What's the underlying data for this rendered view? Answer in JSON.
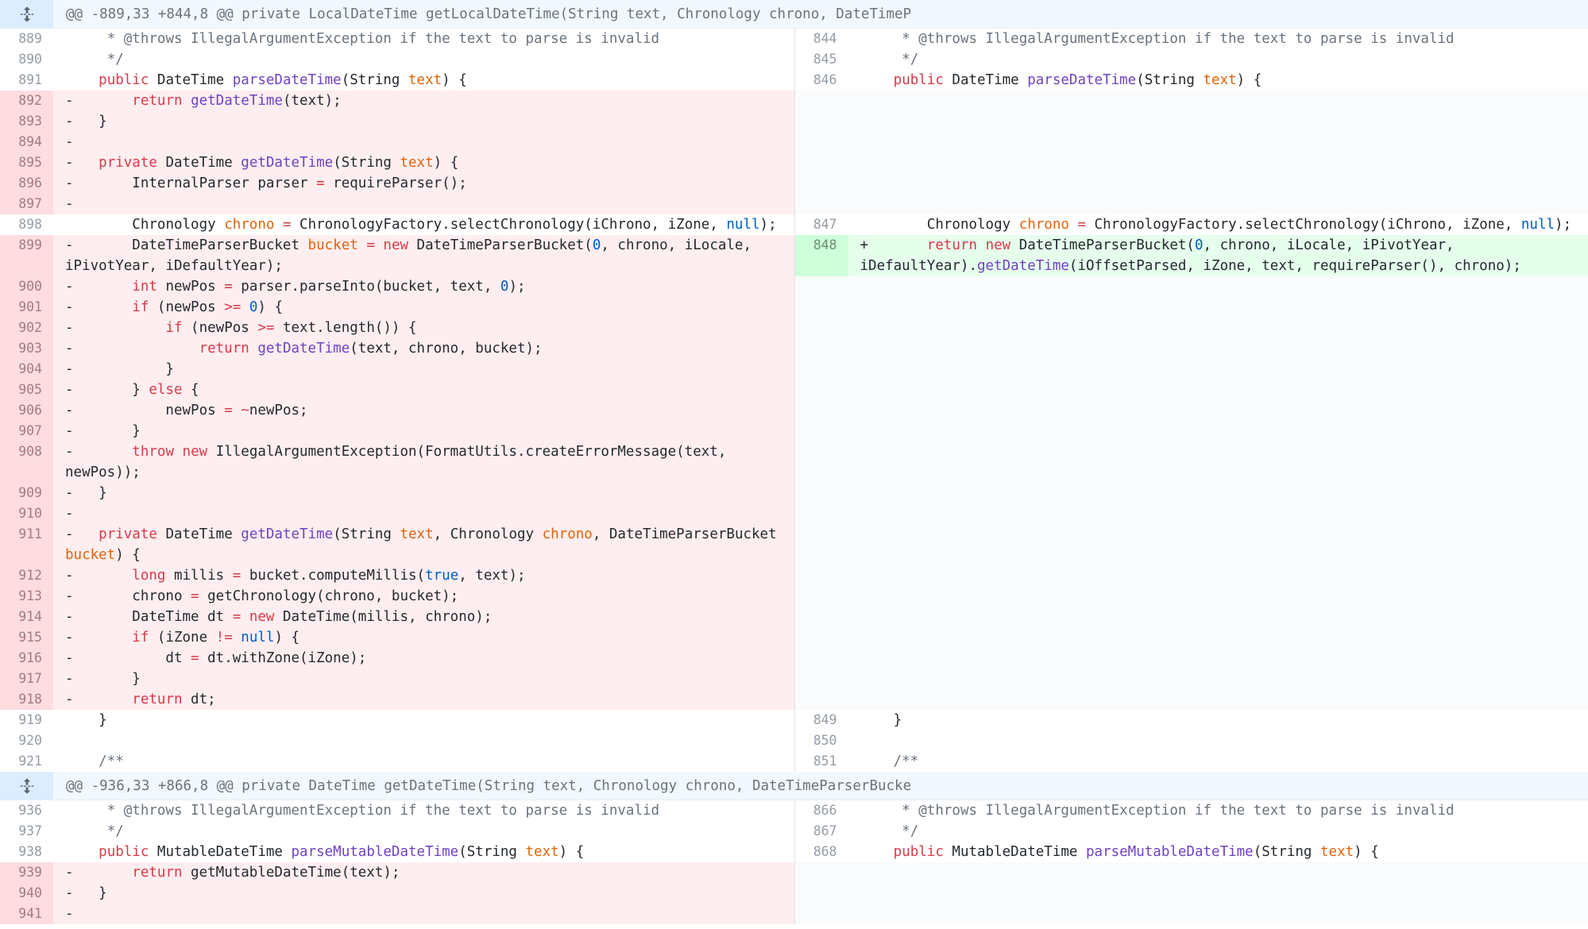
{
  "colors": {
    "deletion_bg": "#ffeef0",
    "addition_bg": "#e6ffed",
    "hunk_bg": "#f1f8ff",
    "keyword": "#d73a49",
    "function": "#6f42c1",
    "param": "#e36209",
    "literal": "#005cc5"
  },
  "expander_icon": "unfold-icon",
  "hunks": [
    {
      "header": "@@ -889,33 +844,8 @@ private LocalDateTime getLocalDateTime(String text, Chronology chrono, DateTimeP",
      "rows": [
        {
          "l": {
            "n": "889",
            "t": "ctx",
            "c": "     * @throws IllegalArgumentException if the text to parse is invalid"
          },
          "r": {
            "n": "844",
            "t": "ctx",
            "c": "     * @throws IllegalArgumentException if the text to parse is invalid"
          }
        },
        {
          "l": {
            "n": "890",
            "t": "ctx",
            "c": "     */"
          },
          "r": {
            "n": "845",
            "t": "ctx",
            "c": "     */"
          }
        },
        {
          "l": {
            "n": "891",
            "t": "ctx",
            "c": "    public DateTime parseDateTime(String text) {"
          },
          "r": {
            "n": "846",
            "t": "ctx",
            "c": "    public DateTime parseDateTime(String text) {"
          }
        },
        {
          "l": {
            "n": "892",
            "t": "del",
            "c": "-       return getDateTime(text);"
          },
          "r": {
            "n": "",
            "t": "empty",
            "c": ""
          }
        },
        {
          "l": {
            "n": "893",
            "t": "del",
            "c": "-   }"
          },
          "r": {
            "n": "",
            "t": "empty",
            "c": ""
          }
        },
        {
          "l": {
            "n": "894",
            "t": "del",
            "c": "-"
          },
          "r": {
            "n": "",
            "t": "empty",
            "c": ""
          }
        },
        {
          "l": {
            "n": "895",
            "t": "del",
            "c": "-   private DateTime getDateTime(String text) {"
          },
          "r": {
            "n": "",
            "t": "empty",
            "c": ""
          }
        },
        {
          "l": {
            "n": "896",
            "t": "del",
            "c": "-       InternalParser parser = requireParser();"
          },
          "r": {
            "n": "",
            "t": "empty",
            "c": ""
          }
        },
        {
          "l": {
            "n": "897",
            "t": "del",
            "c": "-"
          },
          "r": {
            "n": "",
            "t": "empty",
            "c": ""
          }
        },
        {
          "l": {
            "n": "898",
            "t": "ctx",
            "c": "        Chronology chrono = ChronologyFactory.selectChronology(iChrono, iZone, null);"
          },
          "r": {
            "n": "847",
            "t": "ctx",
            "c": "        Chronology chrono = ChronologyFactory.selectChronology(iChrono, iZone, null);"
          }
        },
        {
          "l": {
            "n": "899",
            "t": "del",
            "c": "-       DateTimeParserBucket bucket = new DateTimeParserBucket(0, chrono, iLocale, iPivotYear, iDefaultYear);"
          },
          "r": {
            "n": "848",
            "t": "add",
            "c": "+       return new DateTimeParserBucket(0, chrono, iLocale, iPivotYear, iDefaultYear).getDateTime(iOffsetParsed, iZone, text, requireParser(), chrono);"
          }
        },
        {
          "l": {
            "n": "900",
            "t": "del",
            "c": "-       int newPos = parser.parseInto(bucket, text, 0);"
          },
          "r": {
            "n": "",
            "t": "empty",
            "c": ""
          }
        },
        {
          "l": {
            "n": "901",
            "t": "del",
            "c": "-       if (newPos >= 0) {"
          },
          "r": {
            "n": "",
            "t": "empty",
            "c": ""
          }
        },
        {
          "l": {
            "n": "902",
            "t": "del",
            "c": "-           if (newPos >= text.length()) {"
          },
          "r": {
            "n": "",
            "t": "empty",
            "c": ""
          }
        },
        {
          "l": {
            "n": "903",
            "t": "del",
            "c": "-               return getDateTime(text, chrono, bucket);"
          },
          "r": {
            "n": "",
            "t": "empty",
            "c": ""
          }
        },
        {
          "l": {
            "n": "904",
            "t": "del",
            "c": "-           }"
          },
          "r": {
            "n": "",
            "t": "empty",
            "c": ""
          }
        },
        {
          "l": {
            "n": "905",
            "t": "del",
            "c": "-       } else {"
          },
          "r": {
            "n": "",
            "t": "empty",
            "c": ""
          }
        },
        {
          "l": {
            "n": "906",
            "t": "del",
            "c": "-           newPos = ~newPos;"
          },
          "r": {
            "n": "",
            "t": "empty",
            "c": ""
          }
        },
        {
          "l": {
            "n": "907",
            "t": "del",
            "c": "-       }"
          },
          "r": {
            "n": "",
            "t": "empty",
            "c": ""
          }
        },
        {
          "l": {
            "n": "908",
            "t": "del",
            "c": "-       throw new IllegalArgumentException(FormatUtils.createErrorMessage(text, newPos));"
          },
          "r": {
            "n": "",
            "t": "empty",
            "c": ""
          }
        },
        {
          "l": {
            "n": "909",
            "t": "del",
            "c": "-   }"
          },
          "r": {
            "n": "",
            "t": "empty",
            "c": ""
          }
        },
        {
          "l": {
            "n": "910",
            "t": "del",
            "c": "-"
          },
          "r": {
            "n": "",
            "t": "empty",
            "c": ""
          }
        },
        {
          "l": {
            "n": "911",
            "t": "del",
            "c": "-   private DateTime getDateTime(String text, Chronology chrono, DateTimeParserBucket bucket) {"
          },
          "r": {
            "n": "",
            "t": "empty",
            "c": ""
          }
        },
        {
          "l": {
            "n": "912",
            "t": "del",
            "c": "-       long millis = bucket.computeMillis(true, text);"
          },
          "r": {
            "n": "",
            "t": "empty",
            "c": ""
          }
        },
        {
          "l": {
            "n": "913",
            "t": "del",
            "c": "-       chrono = getChronology(chrono, bucket);"
          },
          "r": {
            "n": "",
            "t": "empty",
            "c": ""
          }
        },
        {
          "l": {
            "n": "914",
            "t": "del",
            "c": "-       DateTime dt = new DateTime(millis, chrono);"
          },
          "r": {
            "n": "",
            "t": "empty",
            "c": ""
          }
        },
        {
          "l": {
            "n": "915",
            "t": "del",
            "c": "-       if (iZone != null) {"
          },
          "r": {
            "n": "",
            "t": "empty",
            "c": ""
          }
        },
        {
          "l": {
            "n": "916",
            "t": "del",
            "c": "-           dt = dt.withZone(iZone);"
          },
          "r": {
            "n": "",
            "t": "empty",
            "c": ""
          }
        },
        {
          "l": {
            "n": "917",
            "t": "del",
            "c": "-       }"
          },
          "r": {
            "n": "",
            "t": "empty",
            "c": ""
          }
        },
        {
          "l": {
            "n": "918",
            "t": "del",
            "c": "-       return dt;"
          },
          "r": {
            "n": "",
            "t": "empty",
            "c": ""
          }
        },
        {
          "l": {
            "n": "919",
            "t": "ctx",
            "c": "    }"
          },
          "r": {
            "n": "849",
            "t": "ctx",
            "c": "    }"
          }
        },
        {
          "l": {
            "n": "920",
            "t": "ctx",
            "c": ""
          },
          "r": {
            "n": "850",
            "t": "ctx",
            "c": ""
          }
        },
        {
          "l": {
            "n": "921",
            "t": "ctx",
            "c": "    /**"
          },
          "r": {
            "n": "851",
            "t": "ctx",
            "c": "    /**"
          }
        }
      ]
    },
    {
      "header": "@@ -936,33 +866,8 @@ private DateTime getDateTime(String text, Chronology chrono, DateTimeParserBucke",
      "rows": [
        {
          "l": {
            "n": "936",
            "t": "ctx",
            "c": "     * @throws IllegalArgumentException if the text to parse is invalid"
          },
          "r": {
            "n": "866",
            "t": "ctx",
            "c": "     * @throws IllegalArgumentException if the text to parse is invalid"
          }
        },
        {
          "l": {
            "n": "937",
            "t": "ctx",
            "c": "     */"
          },
          "r": {
            "n": "867",
            "t": "ctx",
            "c": "     */"
          }
        },
        {
          "l": {
            "n": "938",
            "t": "ctx",
            "c": "    public MutableDateTime parseMutableDateTime(String text) {"
          },
          "r": {
            "n": "868",
            "t": "ctx",
            "c": "    public MutableDateTime parseMutableDateTime(String text) {"
          }
        },
        {
          "l": {
            "n": "939",
            "t": "del",
            "c": "-       return getMutableDateTime(text);"
          },
          "r": {
            "n": "",
            "t": "empty",
            "c": ""
          }
        },
        {
          "l": {
            "n": "940",
            "t": "del",
            "c": "-   }"
          },
          "r": {
            "n": "",
            "t": "empty",
            "c": ""
          }
        },
        {
          "l": {
            "n": "941",
            "t": "del",
            "c": "-"
          },
          "r": {
            "n": "",
            "t": "empty",
            "c": ""
          }
        }
      ]
    }
  ]
}
